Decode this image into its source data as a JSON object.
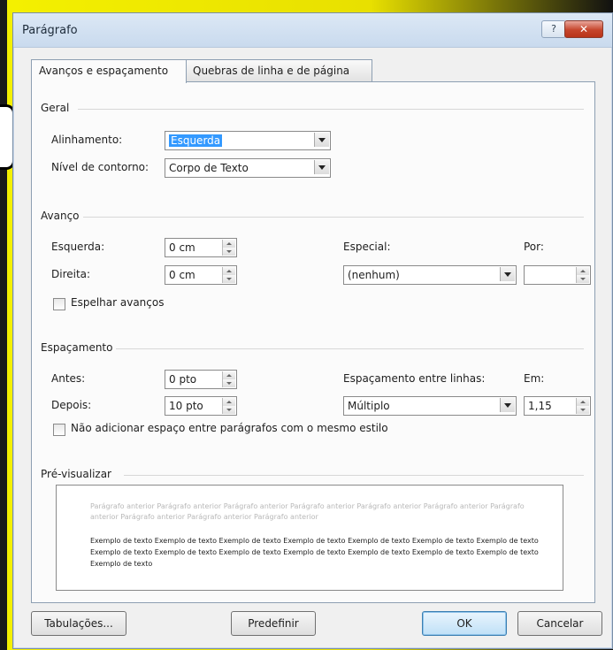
{
  "window": {
    "title": "Parágrafo",
    "help_label": "?",
    "close_label": "✕"
  },
  "tabs": [
    {
      "label": "Avanços e espaçamento",
      "active": true
    },
    {
      "label": "Quebras de linha e de página",
      "active": false
    }
  ],
  "geral": {
    "title": "Geral",
    "alinhamento_label": "Alinhamento:",
    "alinhamento_value": "Esquerda",
    "nivel_label": "Nível de contorno:",
    "nivel_value": "Corpo de Texto"
  },
  "avanco": {
    "title": "Avanço",
    "esquerda_label": "Esquerda:",
    "esquerda_value": "0 cm",
    "direita_label": "Direita:",
    "direita_value": "0 cm",
    "especial_label": "Especial:",
    "especial_value": "(nenhum)",
    "por_label": "Por:",
    "por_value": "",
    "espelhar_label": "Espelhar avanços"
  },
  "espacamento": {
    "title": "Espaçamento",
    "antes_label": "Antes:",
    "antes_value": "0 pto",
    "depois_label": "Depois:",
    "depois_value": "10 pto",
    "entre_linhas_label": "Espaçamento entre linhas:",
    "entre_linhas_value": "Múltiplo",
    "em_label": "Em:",
    "em_value": "1,15",
    "nao_adicionar_label": "Não adicionar espaço entre parágrafos com o mesmo estilo"
  },
  "preview": {
    "title": "Pré-visualizar",
    "previous_text": "Parágrafo anterior Parágrafo anterior Parágrafo anterior Parágrafo anterior Parágrafo anterior Parágrafo anterior Parágrafo anterior Parágrafo anterior Parágrafo anterior Parágrafo anterior",
    "sample_text": "Exemplo de texto Exemplo de texto Exemplo de texto Exemplo de texto Exemplo de texto Exemplo de texto Exemplo de texto Exemplo de texto Exemplo de texto Exemplo de texto Exemplo de texto Exemplo de texto Exemplo de texto Exemplo de texto Exemplo de texto"
  },
  "buttons": {
    "tabulacoes": "Tabulações...",
    "predefinir": "Predefinir",
    "ok": "OK",
    "cancelar": "Cancelar"
  }
}
